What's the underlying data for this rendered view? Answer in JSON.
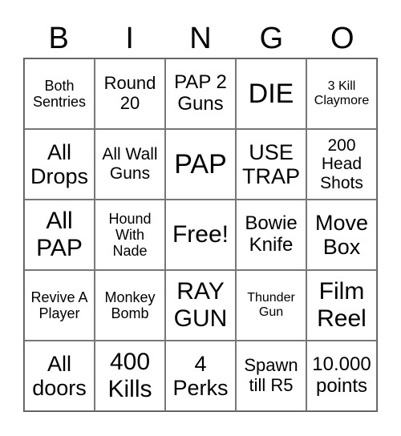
{
  "header": [
    "B",
    "I",
    "N",
    "G",
    "O"
  ],
  "cells": [
    "Both Sentries",
    "Round 20",
    "PAP 2 Guns",
    "DIE",
    "3 Kill Claymore",
    "All Drops",
    "All Wall Guns",
    "PAP",
    "USE TRAP",
    "200 Head Shots",
    "All PAP",
    "Hound With Nade",
    "Free!",
    "Bowie Knife",
    "Move Box",
    "Revive A Player",
    "Monkey Bomb",
    "RAY GUN",
    "Thunder Gun",
    "Film Reel",
    "All doors",
    "400 Kills",
    "4 Perks",
    "Spawn till R5",
    "10.000 points"
  ]
}
